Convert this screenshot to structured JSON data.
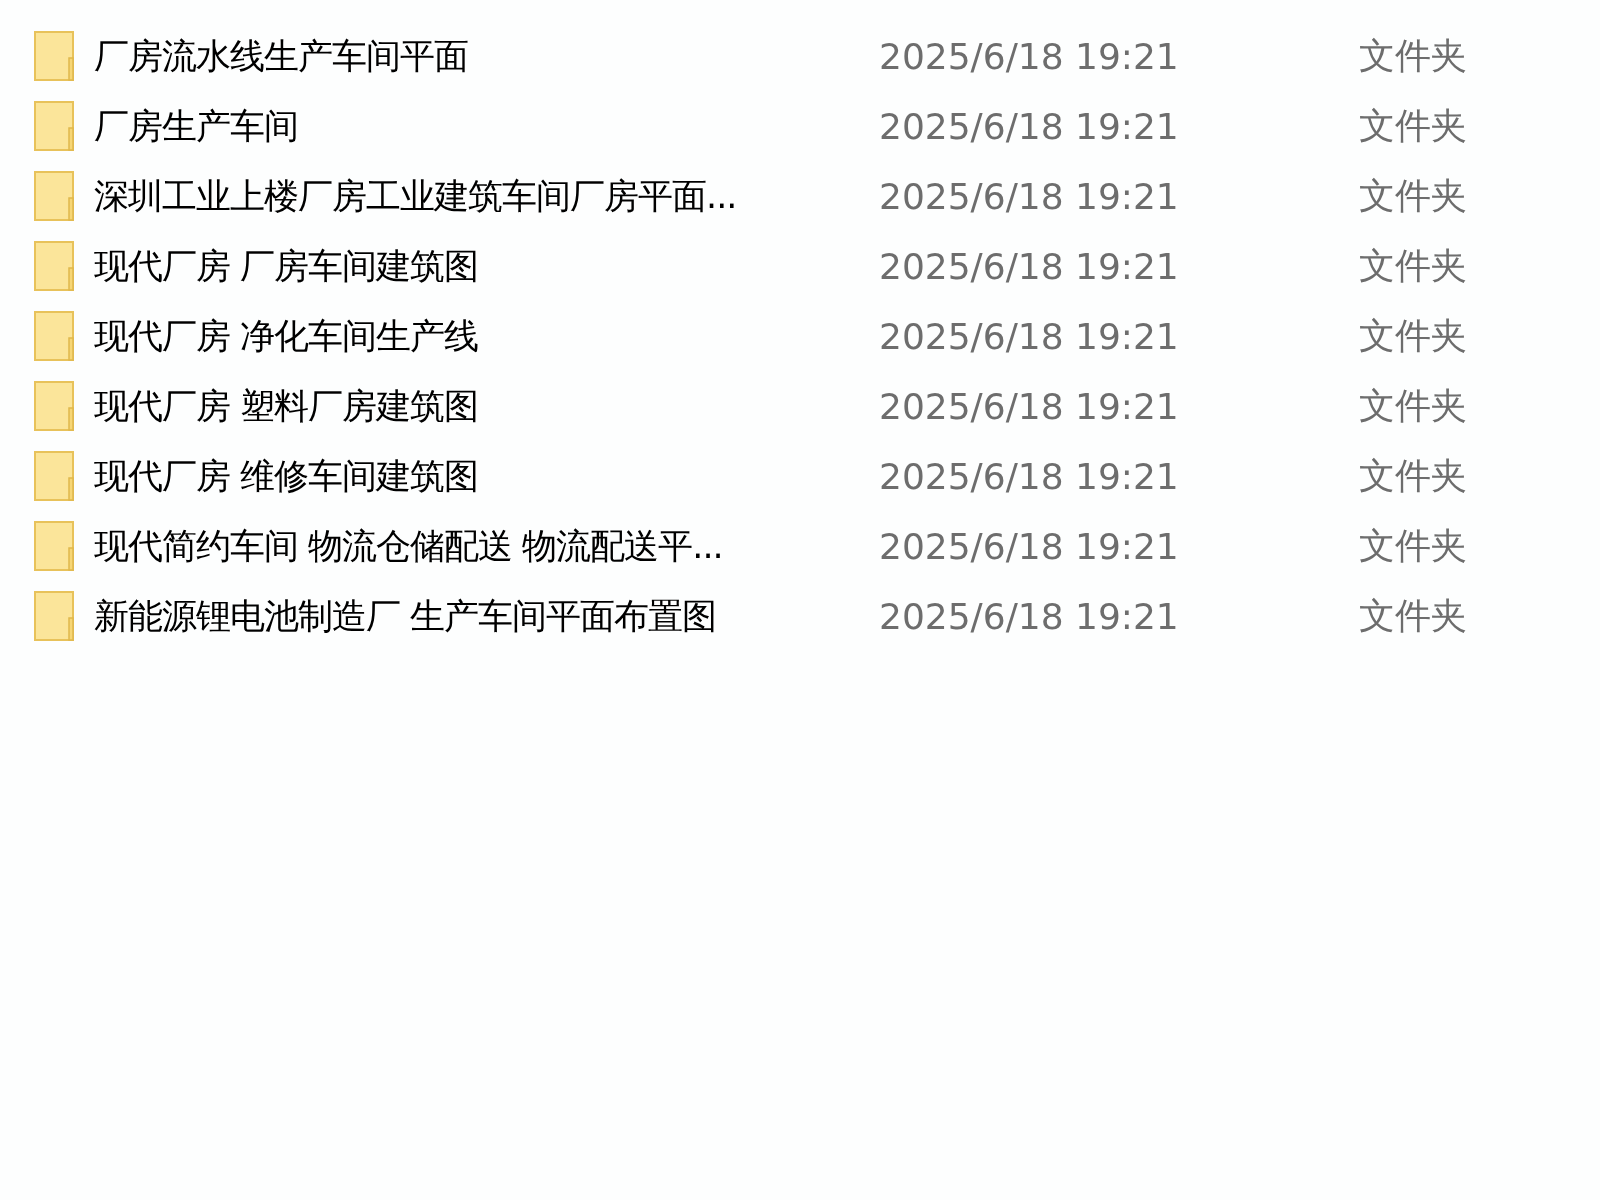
{
  "files": [
    {
      "name": "厂房流水线生产车间平面",
      "modified": "2025/6/18 19:21",
      "type": "文件夹"
    },
    {
      "name": "厂房生产车间",
      "modified": "2025/6/18 19:21",
      "type": "文件夹"
    },
    {
      "name": "深圳工业上楼厂房工业建筑车间厂房平面...",
      "modified": "2025/6/18 19:21",
      "type": "文件夹"
    },
    {
      "name": "现代厂房 厂房车间建筑图",
      "modified": "2025/6/18 19:21",
      "type": "文件夹"
    },
    {
      "name": "现代厂房 净化车间生产线",
      "modified": "2025/6/18 19:21",
      "type": "文件夹"
    },
    {
      "name": "现代厂房 塑料厂房建筑图",
      "modified": "2025/6/18 19:21",
      "type": "文件夹"
    },
    {
      "name": "现代厂房 维修车间建筑图",
      "modified": "2025/6/18 19:21",
      "type": "文件夹"
    },
    {
      "name": "现代简约车间 物流仓储配送 物流配送平...",
      "modified": "2025/6/18 19:21",
      "type": "文件夹"
    },
    {
      "name": "新能源锂电池制造厂 生产车间平面布置图",
      "modified": "2025/6/18 19:21",
      "type": "文件夹"
    }
  ]
}
